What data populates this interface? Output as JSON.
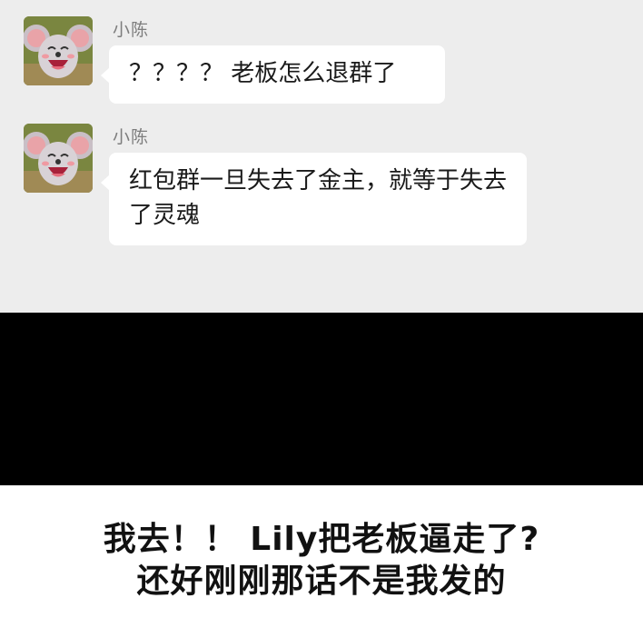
{
  "chat": {
    "messages": [
      {
        "sender": "小陈",
        "avatar_icon": "laughing-mouse-avatar-icon",
        "text": "？？？？ 老板怎么退群了"
      },
      {
        "sender": "小陈",
        "avatar_icon": "laughing-mouse-avatar-icon",
        "text": "红包群一旦失去了金主，就等于失去了灵魂"
      }
    ]
  },
  "caption": {
    "line1": "我去！！ Lily把老板逼走了?",
    "line2": "还好刚刚那话不是我发的"
  },
  "colors": {
    "chat_background": "#ededed",
    "bubble": "#ffffff",
    "sender_name": "#7d7d7d",
    "band": "#000000"
  }
}
